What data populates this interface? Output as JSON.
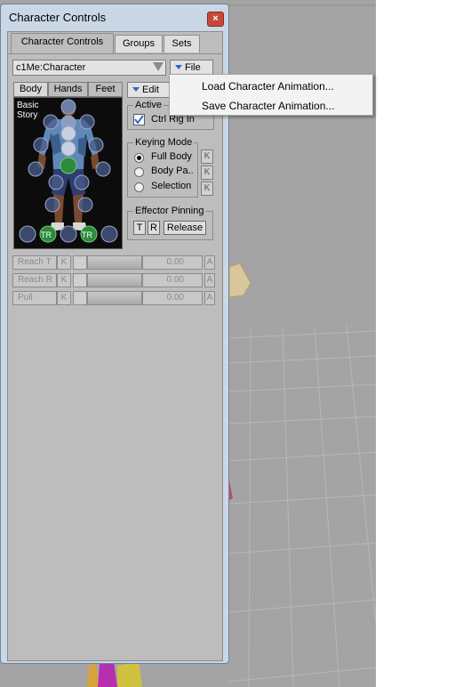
{
  "window": {
    "title": "Character Controls",
    "close_label": "×"
  },
  "tabs": [
    {
      "label": "Character Controls",
      "active": true
    },
    {
      "label": "Groups",
      "active": false
    },
    {
      "label": "Sets",
      "active": false
    }
  ],
  "character_selector": {
    "value": "c1Me:Character"
  },
  "file_menu": {
    "label": "File",
    "items": [
      "Load Character Animation...",
      "Save Character Animation..."
    ]
  },
  "subtabs": [
    {
      "label": "Body",
      "active": true
    },
    {
      "label": "Hands",
      "active": false
    },
    {
      "label": "Feet",
      "active": false
    }
  ],
  "edit_menu": {
    "label": "Edit"
  },
  "character_panel": {
    "mode_line1": "Basic",
    "mode_line2": "Story",
    "tr_left": "TR",
    "tr_right": "TR"
  },
  "active_group": {
    "title": "Active",
    "checkbox_label": "Ctrl Rig In",
    "checked": true
  },
  "keying_mode": {
    "title": "Keying Mode",
    "options": [
      {
        "label": "Full Body",
        "selected": true,
        "k": "K"
      },
      {
        "label": "Body Pa..",
        "selected": false,
        "k": "K"
      },
      {
        "label": "Selection",
        "selected": false,
        "k": "K"
      }
    ]
  },
  "effector_pinning": {
    "title": "Effector Pinning",
    "buttons": [
      "T",
      "R",
      "Release"
    ]
  },
  "sliders": [
    {
      "name": "Reach T",
      "k": "K",
      "value": "0.00",
      "a": "A"
    },
    {
      "name": "Reach R",
      "k": "K",
      "value": "0.00",
      "a": "A"
    },
    {
      "name": "Pull",
      "k": "K",
      "value": "0.00",
      "a": "A"
    }
  ],
  "colors": {
    "window_frame": "#c9d7e6",
    "panel": "#bdbdbd",
    "viewport": "#a4a4a4",
    "close_button": "#c7483a",
    "effector_blue": "#4a5e8c",
    "effector_green": "#2e8a3c"
  }
}
